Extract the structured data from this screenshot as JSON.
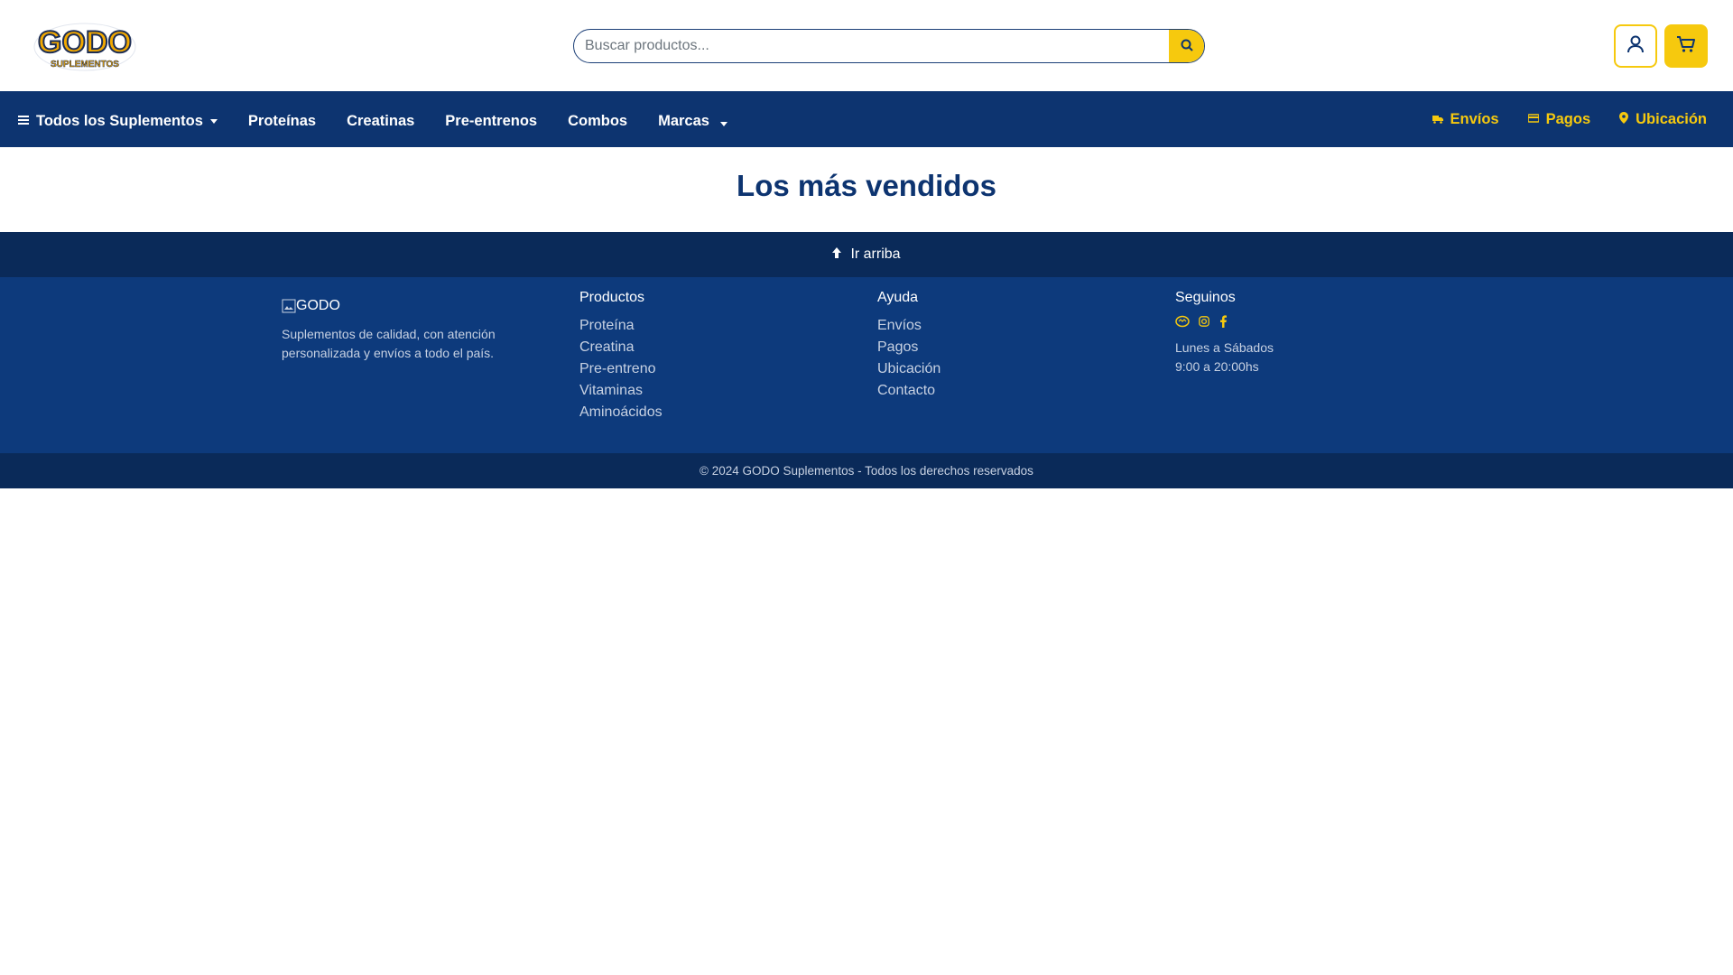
{
  "header": {
    "logo_text": "GODO",
    "logo_subtext": "SUPLEMENTOS",
    "search_placeholder": "Buscar productos..."
  },
  "nav": {
    "left_items": [
      "Todos los Suplementos",
      "Proteínas",
      "Creatinas",
      "Pre-entrenos",
      "Combos",
      "Marcas"
    ],
    "right_items": [
      "Envíos",
      "Pagos",
      "Ubicación"
    ]
  },
  "main": {
    "title": "Los más vendidos"
  },
  "back_to_top": {
    "label": "Ir arriba"
  },
  "footer": {
    "brand_alt": "GODO",
    "description": "Suplementos de calidad, con atención personalizada y envíos a todo el país.",
    "products": {
      "title": "Productos",
      "links": [
        "Proteína",
        "Creatina",
        "Pre-entreno",
        "Vitaminas",
        "Aminoácidos"
      ]
    },
    "help": {
      "title": "Ayuda",
      "links": [
        "Envíos",
        "Pagos",
        "Ubicación",
        "Contacto"
      ]
    },
    "follow": {
      "title": "Seguinos",
      "hours_days": "Lunes a Sábados",
      "hours_time": "9:00 a 20:00hs"
    }
  },
  "copyright": "© 2024 GODO Suplementos - Todos los derechos reservados",
  "colors": {
    "primary": "#0d3470",
    "accent": "#f6c90e",
    "dark": "#0a2a59",
    "footer": "#0d3a7c"
  },
  "icons": {
    "search": "search-icon",
    "user": "user-icon",
    "cart": "cart-icon",
    "menu": "bars-icon",
    "shipping": "truck-icon",
    "payments": "credit-card-icon",
    "location": "map-marker-icon",
    "back_to_top": "arrow-up-icon",
    "social": [
      "mercadolibre-icon",
      "instagram-icon",
      "facebook-icon"
    ]
  }
}
